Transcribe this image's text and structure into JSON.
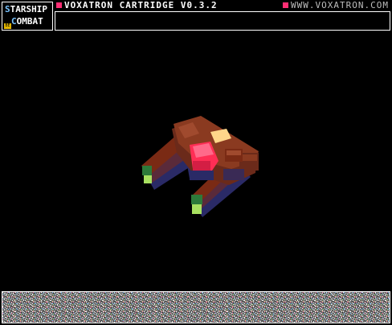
{
  "logo": {
    "line1_initial": "S",
    "line1_rest": "TARSHIP",
    "line2_initial": "C",
    "line2_rest": "OMBAT",
    "badge": "BE"
  },
  "header": {
    "cartridge_title": "VOXATRON CARTRIDGE V0.3.2",
    "url": "WWW.VOXATRON.COM"
  },
  "colors": {
    "accent": "#ff2e74",
    "background": "#000000",
    "hull": "#7a2a14",
    "hull_shadow": "#2a2a66",
    "cockpit": "#ff2e55",
    "engine": "#2d7a3a",
    "engine_glow": "#a8e060",
    "highlight": "#ffd68a"
  },
  "scene": {
    "subject_icon": "starship-voxel-model"
  }
}
